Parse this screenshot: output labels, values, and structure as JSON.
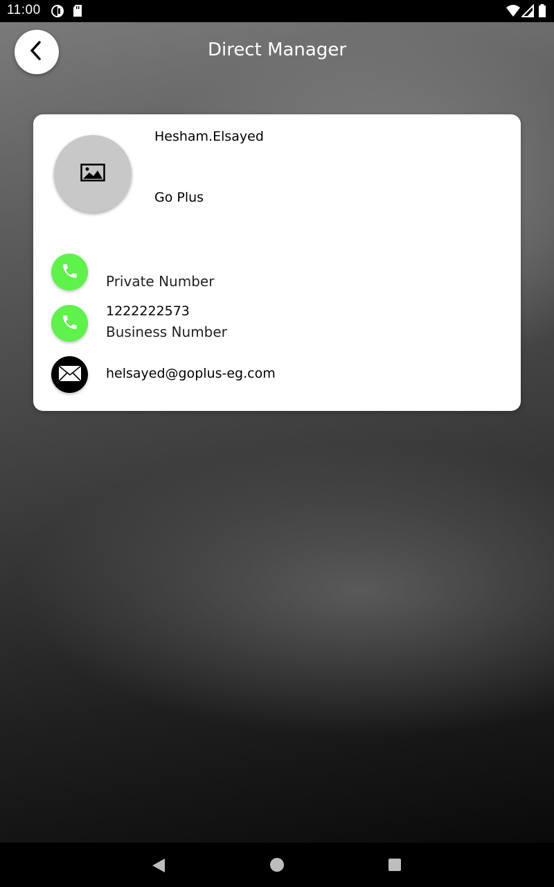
{
  "status_bar": {
    "time": "11:00",
    "icons": [
      "data-saver-icon",
      "sd-card-icon",
      "wifi-icon",
      "signal-icon",
      "battery-icon"
    ]
  },
  "header": {
    "title": "Direct Manager",
    "back_icon": "chevron-left-icon"
  },
  "profile": {
    "name": "Hesham.Elsayed",
    "company": "Go Plus",
    "avatar_icon": "image-placeholder-icon"
  },
  "contacts": {
    "private": {
      "label": "Private Number",
      "value": "",
      "icon": "phone-icon",
      "color": "#5ef24a"
    },
    "business": {
      "label": "Business Number",
      "value": "1222222573",
      "icon": "phone-icon",
      "color": "#5ef24a"
    },
    "email": {
      "value": "helsayed@goplus-eg.com",
      "icon": "mail-icon",
      "color": "#000000"
    }
  },
  "nav_bar": {
    "icons": [
      "back-triangle-icon",
      "home-circle-icon",
      "recents-square-icon"
    ]
  }
}
